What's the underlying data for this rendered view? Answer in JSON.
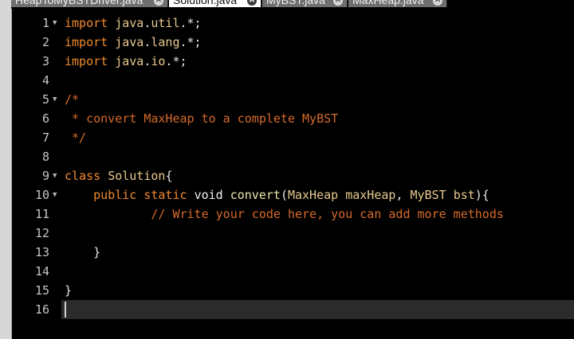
{
  "tabs": [
    {
      "label": "HeapToMyBSTDriver.java",
      "active": false
    },
    {
      "label": "Solution.java",
      "active": true
    },
    {
      "label": "MyBST.java",
      "active": false
    },
    {
      "label": "MaxHeap.java",
      "active": false
    }
  ],
  "close_glyph": "✕",
  "fold_glyph": "▼",
  "colors": {
    "keyword": "#f08a2e",
    "type": "#e8c98e",
    "function": "#e8e8a8",
    "comment": "#d66a2a",
    "background": "#000000"
  },
  "editor": {
    "lines": [
      {
        "n": "1",
        "fold": true,
        "tokens": [
          [
            "kw",
            "import"
          ],
          [
            "pn",
            " "
          ],
          [
            "ty",
            "java"
          ],
          [
            "pn",
            "."
          ],
          [
            "ty",
            "util"
          ],
          [
            "pn",
            ".*;"
          ]
        ]
      },
      {
        "n": "2",
        "fold": false,
        "tokens": [
          [
            "kw",
            "import"
          ],
          [
            "pn",
            " "
          ],
          [
            "ty",
            "java"
          ],
          [
            "pn",
            "."
          ],
          [
            "ty",
            "lang"
          ],
          [
            "pn",
            ".*;"
          ]
        ]
      },
      {
        "n": "3",
        "fold": false,
        "tokens": [
          [
            "kw",
            "import"
          ],
          [
            "pn",
            " "
          ],
          [
            "ty",
            "java"
          ],
          [
            "pn",
            "."
          ],
          [
            "ty",
            "io"
          ],
          [
            "pn",
            ".*;"
          ]
        ]
      },
      {
        "n": "4",
        "fold": false,
        "tokens": []
      },
      {
        "n": "5",
        "fold": true,
        "tokens": [
          [
            "cm",
            "/*"
          ]
        ]
      },
      {
        "n": "6",
        "fold": false,
        "tokens": [
          [
            "cm",
            " * convert MaxHeap to a complete MyBST"
          ]
        ]
      },
      {
        "n": "7",
        "fold": false,
        "tokens": [
          [
            "cm",
            " */"
          ]
        ]
      },
      {
        "n": "8",
        "fold": false,
        "tokens": []
      },
      {
        "n": "9",
        "fold": true,
        "tokens": [
          [
            "kw",
            "class"
          ],
          [
            "pn",
            " "
          ],
          [
            "ty",
            "Solution"
          ],
          [
            "pn",
            "{"
          ]
        ]
      },
      {
        "n": "10",
        "fold": true,
        "tokens": [
          [
            "pn",
            "    "
          ],
          [
            "kw",
            "public"
          ],
          [
            "pn",
            " "
          ],
          [
            "kw",
            "static"
          ],
          [
            "pn",
            " "
          ],
          [
            "pl",
            "void"
          ],
          [
            "pn",
            " "
          ],
          [
            "fn",
            "convert"
          ],
          [
            "pn",
            "("
          ],
          [
            "ty",
            "MaxHeap"
          ],
          [
            "pn",
            " "
          ],
          [
            "ty",
            "maxHeap"
          ],
          [
            "pn",
            ", "
          ],
          [
            "ty",
            "MyBST"
          ],
          [
            "pn",
            " "
          ],
          [
            "ty",
            "bst"
          ],
          [
            "pn",
            "){"
          ]
        ]
      },
      {
        "n": "11",
        "fold": false,
        "tokens": [
          [
            "pn",
            "            "
          ],
          [
            "cm",
            "// Write your code here, you can add more methods"
          ]
        ]
      },
      {
        "n": "12",
        "fold": false,
        "tokens": []
      },
      {
        "n": "13",
        "fold": false,
        "tokens": [
          [
            "pn",
            "    }"
          ]
        ]
      },
      {
        "n": "14",
        "fold": false,
        "tokens": []
      },
      {
        "n": "15",
        "fold": false,
        "tokens": [
          [
            "pn",
            "}"
          ]
        ]
      },
      {
        "n": "16",
        "fold": false,
        "tokens": []
      }
    ]
  }
}
